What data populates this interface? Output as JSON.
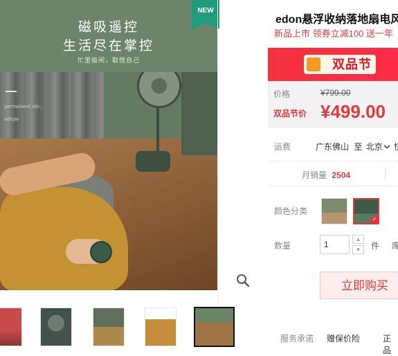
{
  "gallery": {
    "main_badge": "NEW",
    "headline_line1": "磁吸遥控",
    "headline_line2": "生活尽在掌控",
    "headline_sub": "忙里偷闲，取悦自己",
    "small_text_1": "permanent etc.",
    "small_text_2": "adaps",
    "zoom_icon": "magnifier-icon",
    "thumbnails": [
      "thumb-1",
      "thumb-2",
      "thumb-3",
      "thumb-4",
      "thumb-5"
    ],
    "active_thumbnail": 5
  },
  "product": {
    "title": "edon悬浮收纳落地扇电风",
    "subtitle": "新品上市 领券立减100 送一年"
  },
  "promo": {
    "banner_label": "双品节",
    "accent_color": "#ff2b47"
  },
  "price": {
    "original_label": "价格",
    "original_value": "¥799.00",
    "promo_label": "双品节价",
    "promo_value": "¥499.00",
    "promo_color": "#e4393c"
  },
  "shipping": {
    "label": "运费",
    "from": "广东佛山",
    "to_word": "至",
    "destination": "北京",
    "suffix": "快"
  },
  "sales": {
    "label": "月销量",
    "value": "2504"
  },
  "options": {
    "color_label": "颜色分类",
    "quantity_label": "数量",
    "quantity_value": "1",
    "unit": "件",
    "stock_prefix": "库"
  },
  "actions": {
    "buy_now": "立即购买"
  },
  "service": {
    "label": "服务承诺",
    "items": [
      "赠保价险",
      "正品"
    ]
  }
}
